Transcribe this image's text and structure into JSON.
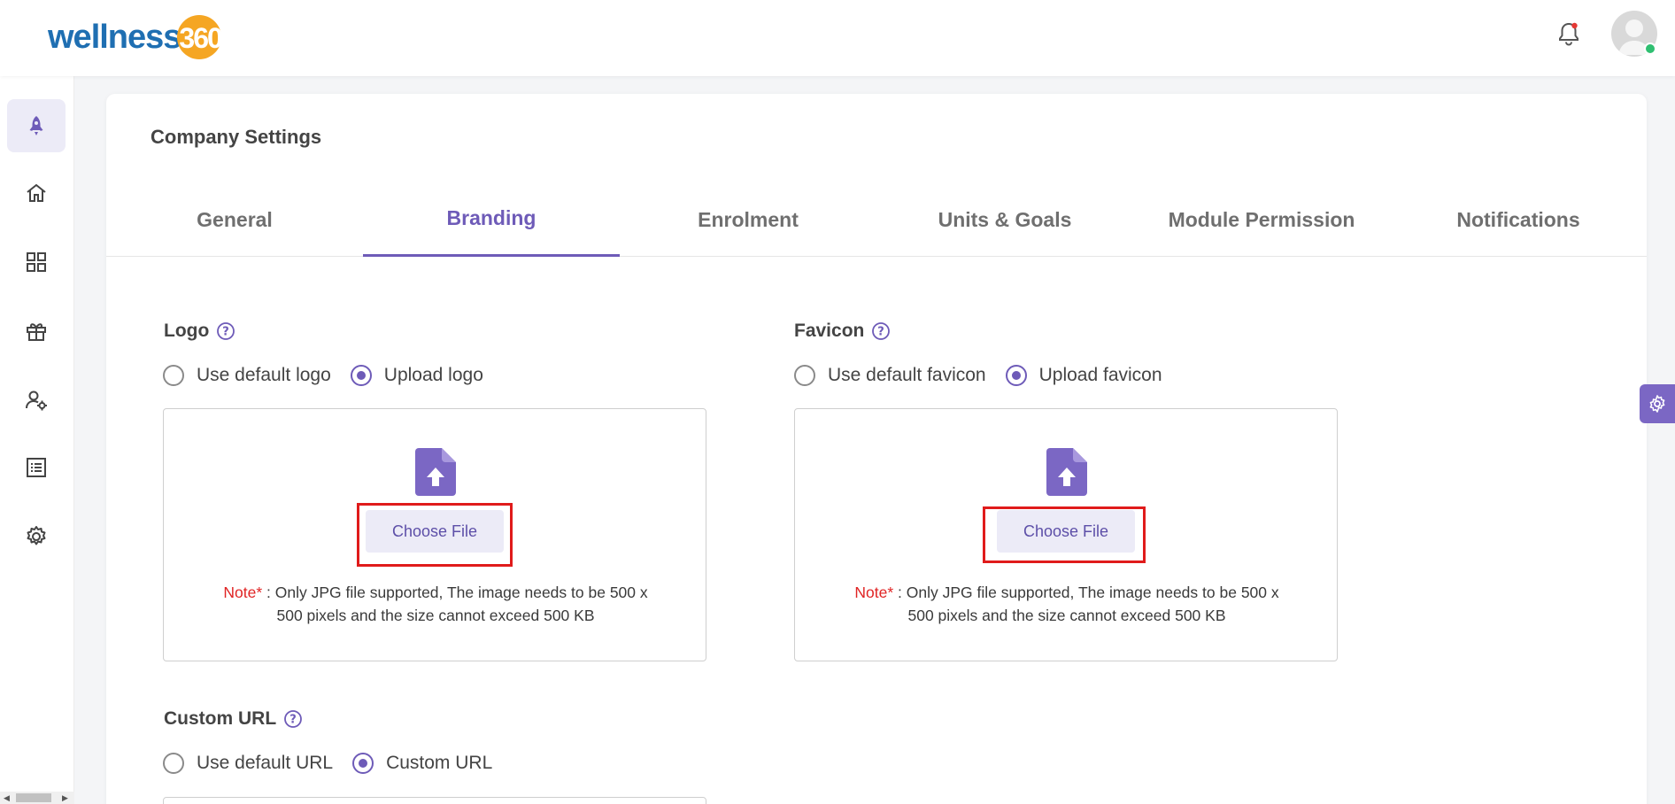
{
  "app": {
    "logo_word": "wellness",
    "logo_number": "360"
  },
  "page": {
    "title": "Company Settings"
  },
  "tabs": [
    {
      "label": "General",
      "active": false
    },
    {
      "label": "Branding",
      "active": true
    },
    {
      "label": "Enrolment",
      "active": false
    },
    {
      "label": "Units & Goals",
      "active": false
    },
    {
      "label": "Module Permission",
      "active": false
    },
    {
      "label": "Notifications",
      "active": false
    }
  ],
  "logo_section": {
    "label": "Logo",
    "option_default": "Use default logo",
    "option_upload": "Upload logo",
    "selected": "upload",
    "choose_file": "Choose File",
    "note_prefix": "Note*",
    "note_line1": " : Only JPG file supported, The image needs to be 500 x",
    "note_line2": "500 pixels and the size cannot exceed 500 KB"
  },
  "favicon_section": {
    "label": "Favicon",
    "option_default": "Use default favicon",
    "option_upload": "Upload favicon",
    "selected": "upload",
    "choose_file": "Choose File",
    "note_prefix": "Note*",
    "note_line1": " : Only JPG file supported, The image needs to be 500 x",
    "note_line2": "500 pixels and the size cannot exceed 500 KB"
  },
  "custom_url_section": {
    "label": "Custom URL",
    "option_default": "Use default URL",
    "option_custom": "Custom URL",
    "selected": "custom"
  },
  "sidebar": {
    "items": [
      {
        "icon": "rocket-icon",
        "active": true
      },
      {
        "icon": "home-icon",
        "active": false
      },
      {
        "icon": "dashboard-grid-icon",
        "active": false
      },
      {
        "icon": "gift-icon",
        "active": false
      },
      {
        "icon": "user-settings-icon",
        "active": false
      },
      {
        "icon": "list-icon",
        "active": false
      },
      {
        "icon": "gear-icon",
        "active": false
      }
    ]
  },
  "colors": {
    "accent": "#6e5bb8",
    "highlight_outline": "#e01b1b",
    "note_red": "#e02424",
    "online_status": "#2fbf71"
  }
}
